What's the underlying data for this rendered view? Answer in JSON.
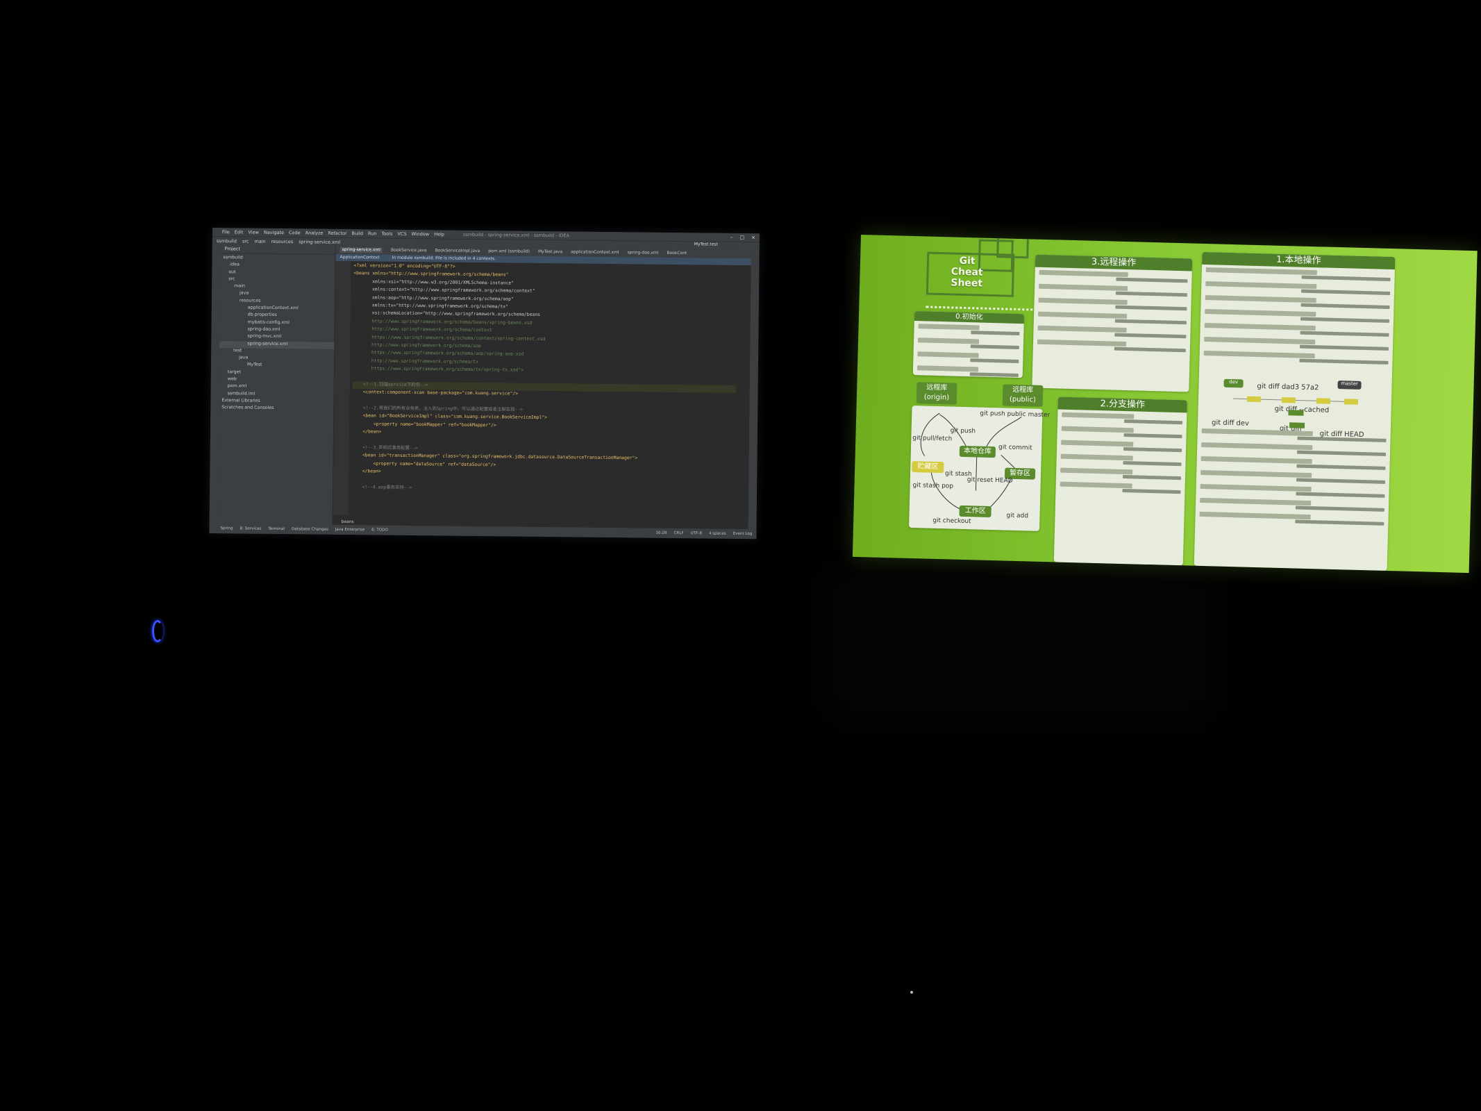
{
  "ide": {
    "menu": [
      "File",
      "Edit",
      "View",
      "Navigate",
      "Code",
      "Analyze",
      "Refactor",
      "Build",
      "Run",
      "Tools",
      "VCS",
      "Window",
      "Help"
    ],
    "window_title": "ssmbuild - spring-service.xml - ssmbuild - IDEA",
    "breadcrumb": [
      "ssmbuild",
      "src",
      "main",
      "resources",
      "spring-service.xml"
    ],
    "run_config": "MyTest.test",
    "project_label": "Project",
    "tree": [
      {
        "label": "ssmbuild"
      },
      {
        "label": ".idea"
      },
      {
        "label": "out"
      },
      {
        "label": "src"
      },
      {
        "label": "main"
      },
      {
        "label": "java"
      },
      {
        "label": "resources"
      },
      {
        "label": "applicationContext.xml"
      },
      {
        "label": "db.properties"
      },
      {
        "label": "mybatis-config.xml"
      },
      {
        "label": "spring-dao.xml"
      },
      {
        "label": "spring-mvc.xml"
      },
      {
        "label": "spring-service.xml"
      },
      {
        "label": "test"
      },
      {
        "label": "java"
      },
      {
        "label": "MyTest"
      },
      {
        "label": "target"
      },
      {
        "label": "web"
      },
      {
        "label": "pom.xml"
      },
      {
        "label": "ssmbuild.iml"
      },
      {
        "label": "External Libraries"
      },
      {
        "label": "Scratches and Consoles"
      }
    ],
    "tabs": [
      "spring-service.xml",
      "BookService.java",
      "BookServiceImpl.java",
      "pom.xml (ssmbuild)",
      "MyTest.java",
      "applicationContext.xml",
      "spring-dao.xml",
      "BookCont"
    ],
    "banner": {
      "context": "ApplicationContext",
      "message": "In module ssmbuild. File is included in 4 contexts."
    },
    "code_lines": [
      "<?xml version=\"1.0\" encoding=\"UTF-8\"?>",
      "<beans xmlns=\"http://www.springframework.org/schema/beans\"",
      "       xmlns:xsi=\"http://www.w3.org/2001/XMLSchema-instance\"",
      "       xmlns:context=\"http://www.springframework.org/schema/context\"",
      "       xmlns:aop=\"http://www.springframework.org/schema/aop\"",
      "       xmlns:tx=\"http://www.springframework.org/schema/tx\"",
      "       xsi:schemaLocation=\"http://www.springframework.org/schema/beans",
      "       http://www.springframework.org/schema/beans/spring-beans.xsd",
      "       http://www.springframework.org/schema/context",
      "       https://www.springframework.org/schema/context/spring-context.xsd",
      "       http://www.springframework.org/schema/aop",
      "       https://www.springframework.org/schema/aop/spring-aop.xsd",
      "       http://www.springframework.org/schema/tx",
      "       https://www.springframework.org/schema/tx/spring-tx.xsd\">",
      "",
      "    <!--1.扫描service下的包-->",
      "    <context:component-scan base-package=\"com.kuang.service\"/>",
      "",
      "    <!--2.将我们的所有业务类，注入到Spring中，可以通过配置或者注解实现-->",
      "    <bean id=\"BookServiceImpl\" class=\"com.kuang.service.BookServiceImpl\">",
      "        <property name=\"bookMapper\" ref=\"bookMapper\"/>",
      "    </bean>",
      "",
      "    <!--3.声明式事务配置-->",
      "    <bean id=\"transactionManager\" class=\"org.springframework.jdbc.datasource.DataSourceTransactionManager\">",
      "        <property name=\"dataSource\" ref=\"dataSource\"/>",
      "    </bean>",
      "",
      "    <!--4.aop事务支持-->"
    ],
    "editor_breadcrumb": "beans",
    "status_tabs": [
      "Spring",
      "8: Services",
      "Terminal",
      "Database Changes",
      "Java Enterprise",
      "6: TODO"
    ],
    "status_right": [
      "16:28",
      "CRLF",
      "UTF-8",
      "4 spaces"
    ],
    "event_log": "Event Log"
  },
  "sheet": {
    "logo": [
      "Git",
      "Cheat Sheet"
    ],
    "sections": [
      {
        "key": "init",
        "title": "0.初始化",
        "rows": 4
      },
      {
        "key": "remote",
        "title": "3.远程操作",
        "rows": 6
      },
      {
        "key": "branch",
        "title": "2.分支操作",
        "rows": 6
      },
      {
        "key": "local",
        "title": "1.本地操作",
        "rows": 7
      }
    ],
    "diagram_labels": {
      "origin": "远程库 (origin)",
      "public": "远程库 (public)",
      "local_repo": "本地仓库",
      "stash": "贮藏区",
      "staging": "暂存区",
      "workspace": "工作区",
      "git_pull_fetch": "git pull/fetch",
      "git_push": "git push",
      "git_push_public": "git push public master",
      "git_commit": "git commit",
      "git_stash": "git stash",
      "git_stash_pop": "git stash pop",
      "git_reset_head": "git reset HEAD",
      "git_checkout": "git checkout",
      "git_add": "git add",
      "diff1": "git diff dad3 57a2",
      "diff2": "git diff --cached",
      "diff3": "git diff",
      "diff4": "git diff HEAD",
      "diff5": "git diff dev",
      "dev": "dev",
      "master": "master"
    }
  },
  "colors": {
    "sheet_green": "#86c833",
    "card_header": "#4f7f2a",
    "ide_bg": "#2b2b2b",
    "ide_panel": "#3c3f41"
  }
}
